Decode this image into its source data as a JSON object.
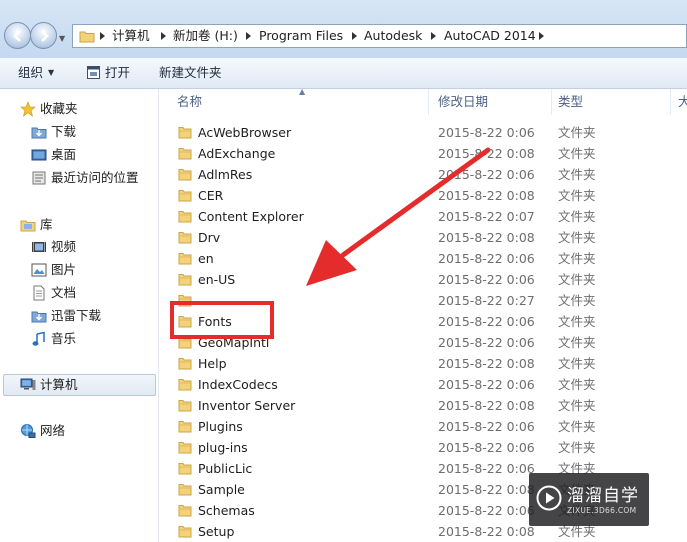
{
  "address_bar": {
    "breadcrumbs": [
      "计算机",
      "新加卷 (H:)",
      "Program Files",
      "Autodesk",
      "AutoCAD 2014"
    ]
  },
  "toolbar": {
    "organize_label": "组织",
    "open_label": "打开",
    "new_folder_label": "新建文件夹"
  },
  "nav_pane": {
    "favorites": {
      "label": "收藏夹",
      "items": [
        "下载",
        "桌面",
        "最近访问的位置"
      ]
    },
    "libraries": {
      "label": "库",
      "items": [
        "视频",
        "图片",
        "文档",
        "迅雷下载",
        "音乐"
      ]
    },
    "computer": {
      "label": "计算机"
    },
    "network": {
      "label": "网络"
    }
  },
  "columns": {
    "name": "名称",
    "modified": "修改日期",
    "type": "类型",
    "size_partial": "大"
  },
  "files": [
    {
      "name": "AcWebBrowser",
      "date": "2015-8-22 0:06",
      "type": "文件夹"
    },
    {
      "name": "AdExchange",
      "date": "2015-8-22 0:08",
      "type": "文件夹"
    },
    {
      "name": "AdlmRes",
      "date": "2015-8-22 0:06",
      "type": "文件夹"
    },
    {
      "name": "CER",
      "date": "2015-8-22 0:08",
      "type": "文件夹"
    },
    {
      "name": "Content Explorer",
      "date": "2015-8-22 0:07",
      "type": "文件夹"
    },
    {
      "name": "Drv",
      "date": "2015-8-22 0:08",
      "type": "文件夹"
    },
    {
      "name": "en",
      "date": "2015-8-22 0:06",
      "type": "文件夹"
    },
    {
      "name": "en-US",
      "date": "2015-8-22 0:06",
      "type": "文件夹"
    },
    {
      "name": "",
      "date": "2015-8-22 0:27",
      "type": "文件夹"
    },
    {
      "name": "Fonts",
      "date": "2015-8-22 0:06",
      "type": "文件夹"
    },
    {
      "name": "GeoMapIntl",
      "date": "2015-8-22 0:06",
      "type": "文件夹"
    },
    {
      "name": "Help",
      "date": "2015-8-22 0:08",
      "type": "文件夹"
    },
    {
      "name": "IndexCodecs",
      "date": "2015-8-22 0:06",
      "type": "文件夹"
    },
    {
      "name": "Inventor Server",
      "date": "2015-8-22 0:08",
      "type": "文件夹"
    },
    {
      "name": "Plugins",
      "date": "2015-8-22 0:06",
      "type": "文件夹"
    },
    {
      "name": "plug-ins",
      "date": "2015-8-22 0:06",
      "type": "文件夹"
    },
    {
      "name": "PublicLic",
      "date": "2015-8-22 0:06",
      "type": "文件夹"
    },
    {
      "name": "Sample",
      "date": "2015-8-22 0:08",
      "type": "文件夹"
    },
    {
      "name": "Schemas",
      "date": "2015-8-22 0:06",
      "type": "文件夹"
    },
    {
      "name": "Setup",
      "date": "2015-8-22 0:08",
      "type": "文件夹"
    }
  ],
  "watermark": {
    "main": "溜溜自学",
    "sub": "ZIXUE.3D66.COM"
  },
  "colors": {
    "annotation_red": "#e42c2c",
    "folder_yellow": "#f3d27a"
  }
}
